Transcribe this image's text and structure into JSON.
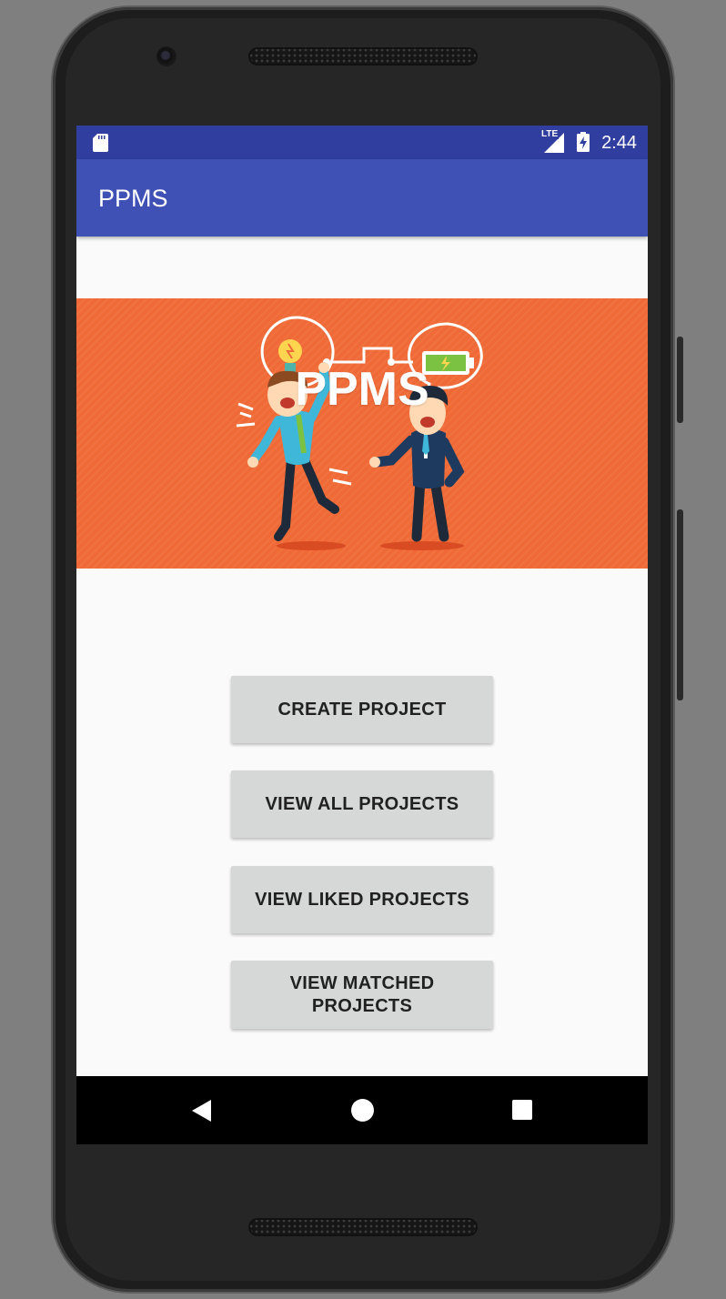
{
  "status_bar": {
    "time": "2:44",
    "network": "LTE",
    "icons": [
      "sd-card-icon",
      "signal-icon",
      "battery-charging-icon"
    ]
  },
  "app_bar": {
    "title": "PPMS"
  },
  "banner": {
    "title": "PPMS",
    "background_color": "#ef6a37"
  },
  "buttons": {
    "create_project": "CREATE PROJECT",
    "view_all_projects": "VIEW ALL PROJECTS",
    "view_liked_projects": "VIEW LIKED PROJECTS",
    "view_matched_projects": "VIEW MATCHED PROJECTS"
  },
  "nav_bar": {
    "icons": [
      "back-icon",
      "home-icon",
      "recents-icon"
    ]
  },
  "colors": {
    "status_bar": "#303f9f",
    "app_bar": "#3f51b5",
    "button_bg": "#d6d7d7"
  }
}
